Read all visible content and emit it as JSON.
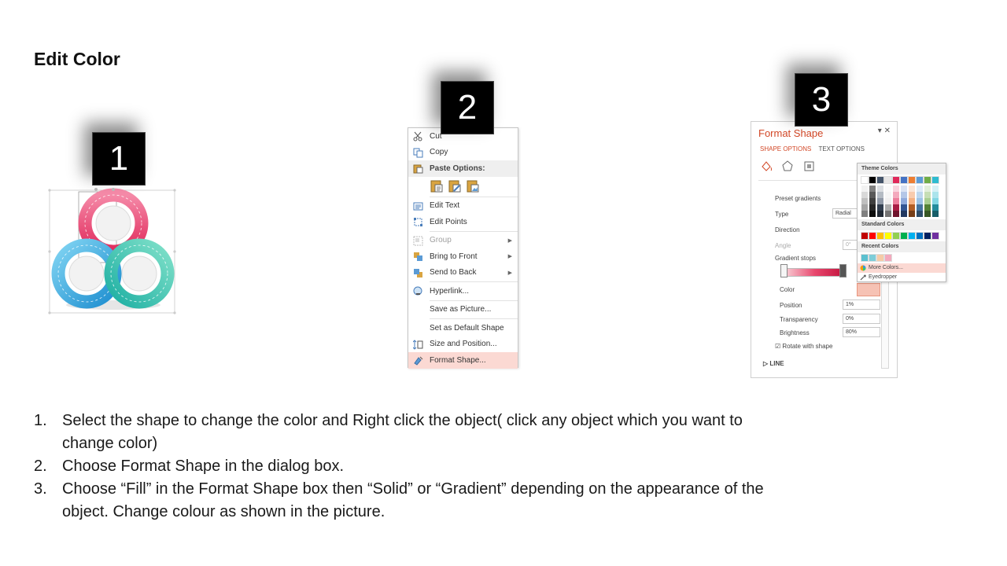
{
  "slide": {
    "title": "Edit Color"
  },
  "badges": [
    "1",
    "2",
    "3"
  ],
  "context_menu": {
    "items": [
      {
        "label": "Cut",
        "icon": "scissors-icon",
        "type": "item"
      },
      {
        "label": "Copy",
        "icon": "copy-icon",
        "type": "item"
      },
      {
        "label": "Paste Options:",
        "icon": "paste-icon",
        "type": "header"
      },
      {
        "type": "paste-row"
      },
      {
        "label": "Edit Text",
        "icon": "edit-text-icon",
        "type": "item"
      },
      {
        "label": "Edit Points",
        "icon": "edit-points-icon",
        "type": "item"
      },
      {
        "label": "Group",
        "icon": "group-icon",
        "type": "item",
        "disabled": true,
        "submenu": true
      },
      {
        "label": "Bring to Front",
        "icon": "bring-front-icon",
        "type": "item",
        "submenu": true
      },
      {
        "label": "Send to Back",
        "icon": "send-back-icon",
        "type": "item",
        "submenu": true
      },
      {
        "label": "Hyperlink...",
        "icon": "hyperlink-icon",
        "type": "item"
      },
      {
        "label": "Save as Picture...",
        "type": "item"
      },
      {
        "label": "Set as Default Shape",
        "type": "item"
      },
      {
        "label": "Size and Position...",
        "icon": "size-position-icon",
        "type": "item"
      },
      {
        "label": "Format Shape...",
        "icon": "format-shape-icon",
        "type": "item",
        "highlighted": true
      }
    ]
  },
  "format_pane": {
    "title": "Format Shape",
    "tab_shape": "SHAPE OPTIONS",
    "tab_text": "TEXT OPTIONS",
    "preset_gradients": "Preset gradients",
    "type_label": "Type",
    "type_value": "Radial",
    "direction_label": "Direction",
    "angle_label": "Angle",
    "angle_value": "0°",
    "gradient_stops_label": "Gradient stops",
    "color_label": "Color",
    "position_label": "Position",
    "position_value": "1%",
    "transparency_label": "Transparency",
    "transparency_value": "0%",
    "brightness_label": "Brightness",
    "brightness_value": "80%",
    "rotate_label": "Rotate with shape",
    "line_label": "LINE"
  },
  "color_picker": {
    "theme_label": "Theme Colors",
    "standard_label": "Standard Colors",
    "recent_label": "Recent Colors",
    "more_colors": "More Colors...",
    "eyedropper": "Eyedropper",
    "theme_top": [
      "#ffffff",
      "#000000",
      "#44546a",
      "#e7e6e6",
      "#e0285a",
      "#4472c4",
      "#ed7d31",
      "#5b9bd5",
      "#70ad47",
      "#2ebbd0"
    ],
    "standard": [
      "#c00000",
      "#ff0000",
      "#ffc000",
      "#ffff00",
      "#92d050",
      "#00b050",
      "#00b0f0",
      "#0070c0",
      "#002060",
      "#7030a0"
    ],
    "recent": [
      "#5bc0cf",
      "#7ecdd8",
      "#f6cba7",
      "#f3a9bd"
    ]
  },
  "instructions": [
    {
      "num": "1.",
      "text": "Select the shape to change the color and Right click the object( click any object which you want to change color)"
    },
    {
      "num": "2.",
      "text": "Choose Format Shape in the dialog box."
    },
    {
      "num": "3.",
      "text": "Choose “Fill” in the Format Shape box then “Solid” or “Gradient” depending on the appearance of the object. Change colour as shown in the picture."
    }
  ]
}
